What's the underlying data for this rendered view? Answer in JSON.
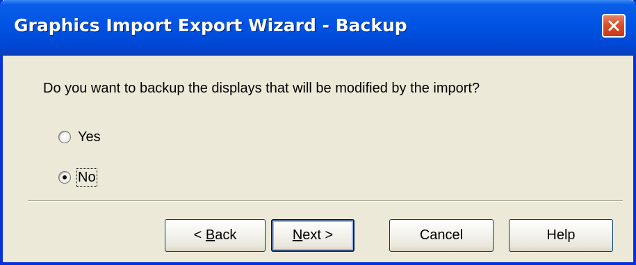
{
  "window": {
    "title": "Graphics Import Export Wizard - Backup",
    "close_icon": "close-icon"
  },
  "content": {
    "prompt": "Do you want to backup the displays that will be modified by the import?",
    "options": [
      {
        "label": "Yes",
        "selected": false
      },
      {
        "label": "No",
        "selected": true
      }
    ]
  },
  "buttons": {
    "back": {
      "prefix": "< ",
      "mnemonic": "B",
      "rest": "ack"
    },
    "next": {
      "mnemonic": "N",
      "rest": "ext >"
    },
    "cancel": "Cancel",
    "help": "Help"
  },
  "colors": {
    "titlebar": "#0054e3",
    "dialog_bg": "#ece9d8",
    "close_button": "#d9502c"
  }
}
